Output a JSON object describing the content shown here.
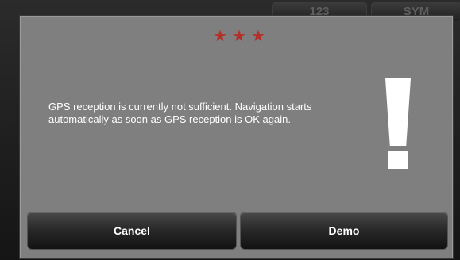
{
  "background": {
    "keys": [
      "123",
      "SYM"
    ]
  },
  "dialog": {
    "stars": [
      "★",
      "★",
      "★"
    ],
    "message": "GPS reception is currently not sufficient. Navigation starts automatically as soon as GPS reception is OK again.",
    "warning_icon": "exclamation-icon",
    "cancel_label": "Cancel",
    "demo_label": "Demo"
  },
  "colors": {
    "dialog_bg": "#7f7f7f",
    "star": "#b3302a",
    "text": "#ffffff"
  }
}
